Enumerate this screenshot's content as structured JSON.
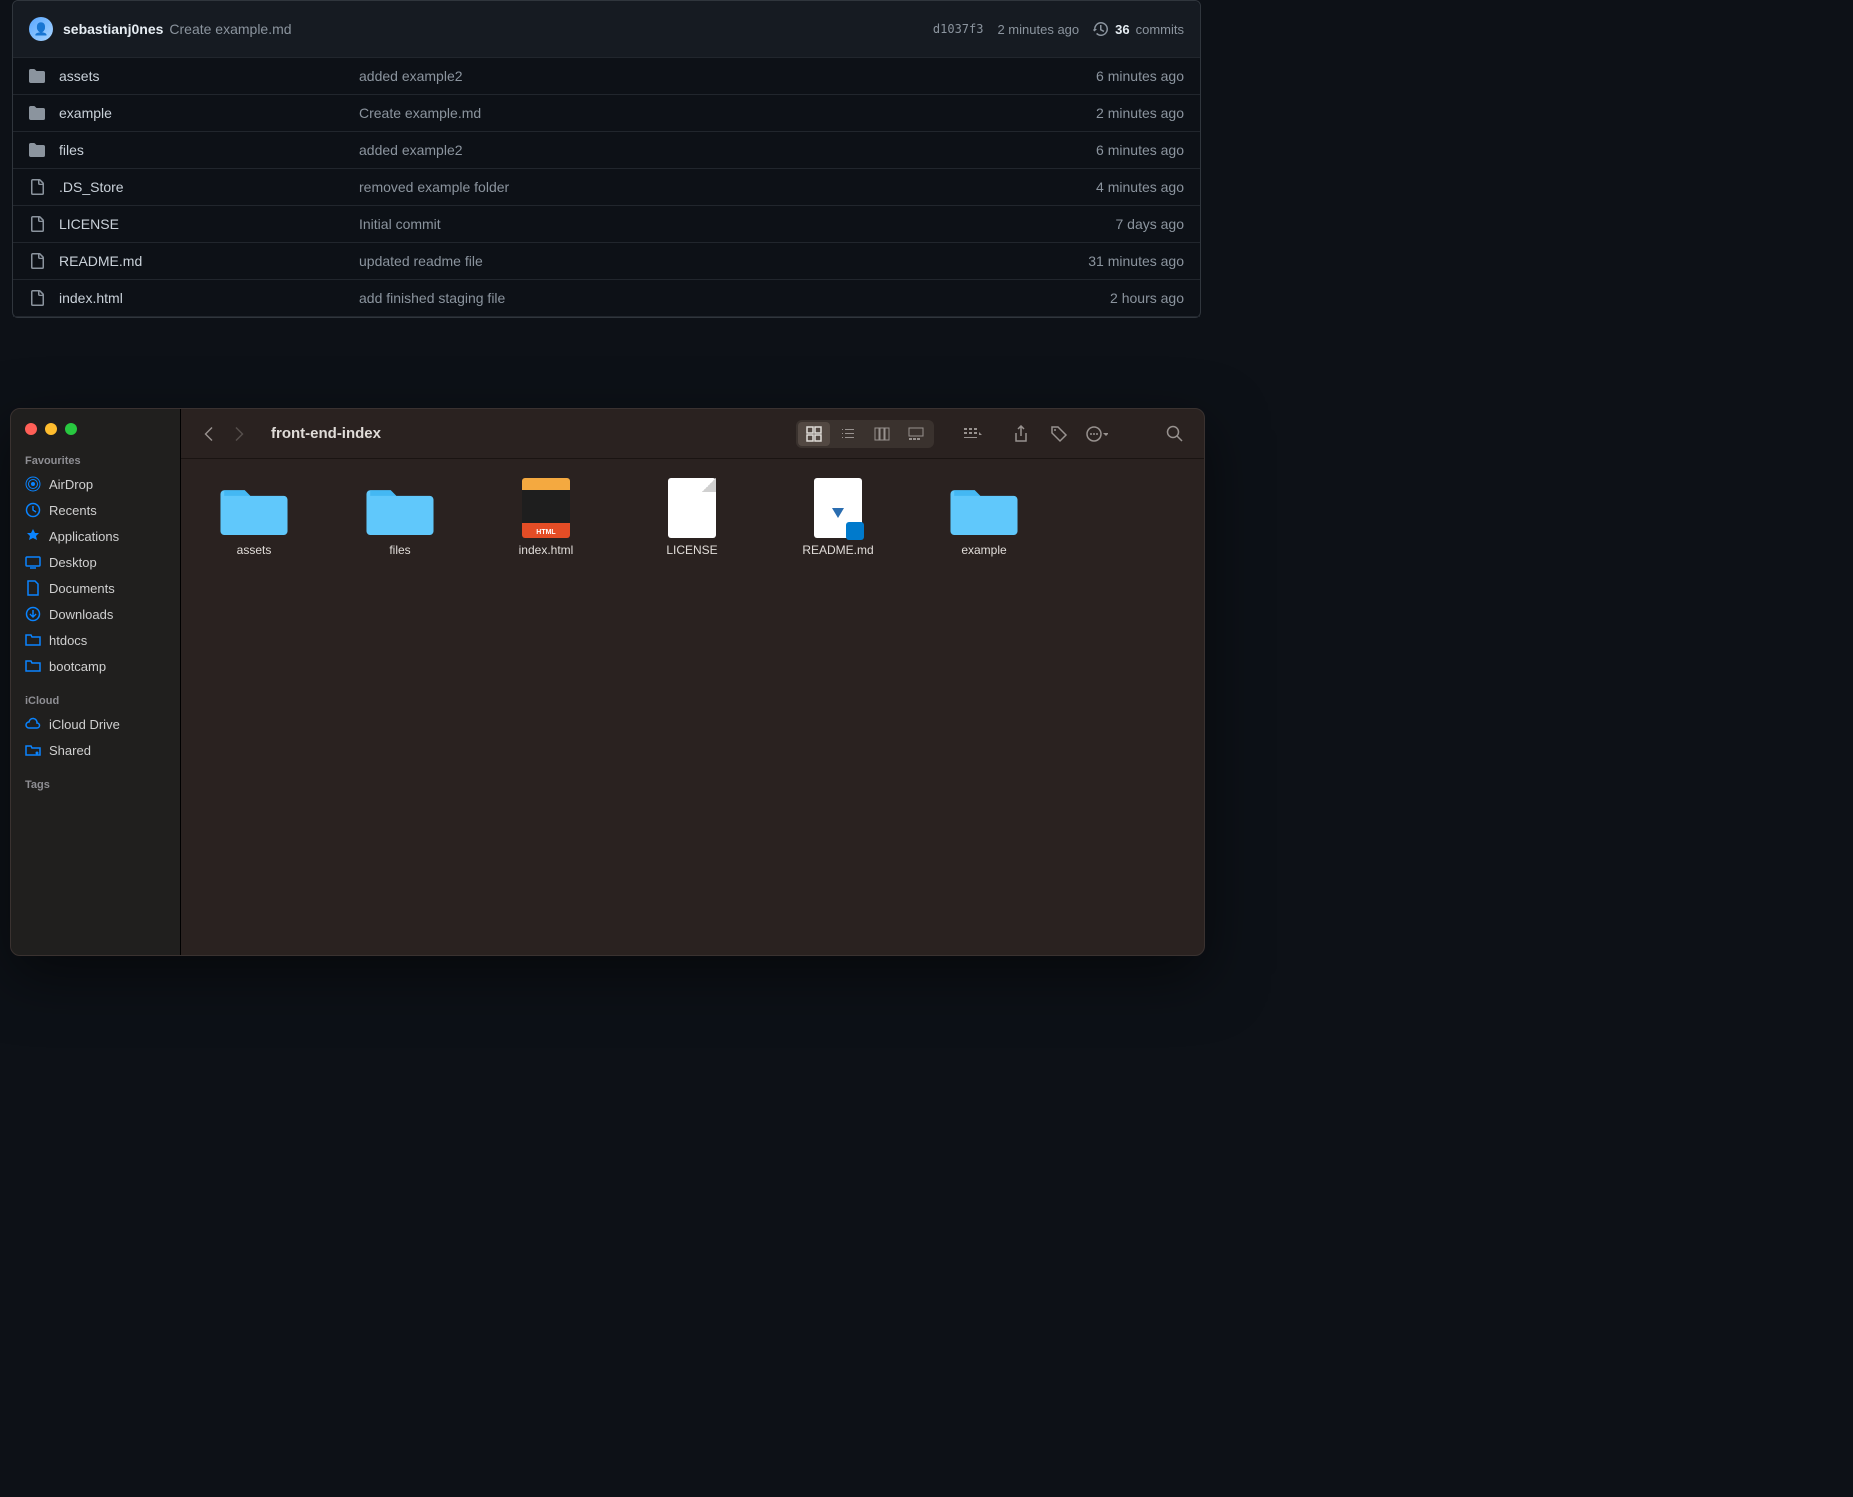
{
  "github": {
    "author": "sebastianj0nes",
    "latest_commit_message": "Create example.md",
    "commit_hash": "d1037f3",
    "commit_time": "2 minutes ago",
    "commit_count": "36",
    "commit_count_label": "commits",
    "files": [
      {
        "type": "folder",
        "name": "assets",
        "message": "added example2",
        "time": "6 minutes ago"
      },
      {
        "type": "folder",
        "name": "example",
        "message": "Create example.md",
        "time": "2 minutes ago"
      },
      {
        "type": "folder",
        "name": "files",
        "message": "added example2",
        "time": "6 minutes ago"
      },
      {
        "type": "file",
        "name": ".DS_Store",
        "message": "removed example folder",
        "time": "4 minutes ago"
      },
      {
        "type": "file",
        "name": "LICENSE",
        "message": "Initial commit",
        "time": "7 days ago"
      },
      {
        "type": "file",
        "name": "README.md",
        "message": "updated readme file",
        "time": "31 minutes ago"
      },
      {
        "type": "file",
        "name": "index.html",
        "message": "add finished staging file",
        "time": "2 hours ago"
      }
    ]
  },
  "finder": {
    "title": "front-end-index",
    "sidebar": {
      "favourites_label": "Favourites",
      "icloud_label": "iCloud",
      "tags_label": "Tags",
      "favourites": [
        {
          "icon": "airdrop",
          "label": "AirDrop"
        },
        {
          "icon": "clock",
          "label": "Recents"
        },
        {
          "icon": "apps",
          "label": "Applications"
        },
        {
          "icon": "desktop",
          "label": "Desktop"
        },
        {
          "icon": "document",
          "label": "Documents"
        },
        {
          "icon": "download",
          "label": "Downloads"
        },
        {
          "icon": "folder",
          "label": "htdocs"
        },
        {
          "icon": "folder",
          "label": "bootcamp"
        }
      ],
      "icloud": [
        {
          "icon": "cloud",
          "label": "iCloud Drive"
        },
        {
          "icon": "shared",
          "label": "Shared"
        }
      ]
    },
    "items": [
      {
        "type": "folder",
        "name": "assets"
      },
      {
        "type": "folder",
        "name": "files"
      },
      {
        "type": "html",
        "name": "index.html"
      },
      {
        "type": "blank",
        "name": "LICENSE"
      },
      {
        "type": "readme",
        "name": "README.md"
      },
      {
        "type": "folder",
        "name": "example"
      }
    ]
  }
}
